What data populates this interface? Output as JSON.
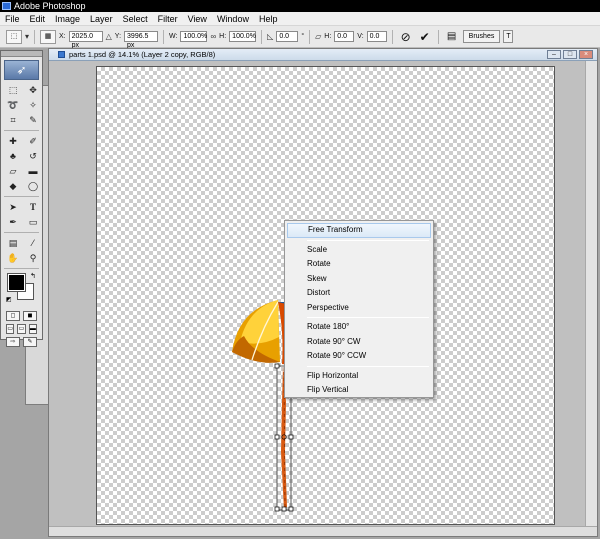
{
  "app": {
    "title": "Adobe Photoshop"
  },
  "menubar": {
    "items": [
      "File",
      "Edit",
      "Image",
      "Layer",
      "Select",
      "Filter",
      "View",
      "Window",
      "Help"
    ]
  },
  "options": {
    "x_label": "X:",
    "x_value": "2025.0 px",
    "y_label": "Y:",
    "y_value": "3996.5 px",
    "w_label": "W:",
    "w_value": "100.0%",
    "h_label": "H:",
    "h_value": "100.0%",
    "angle_value": "0.0",
    "angle_unit": "°",
    "hskew_label": "H:",
    "hskew_value": "0.0",
    "vskew_label": "V:",
    "vskew_value": "0.0",
    "brushes_tab": "Brushes",
    "next_tab": "T"
  },
  "document": {
    "title": "parts 1.psd @ 14.1% (Layer 2 copy, RGB/8)"
  },
  "context_menu": {
    "group1": [
      "Free Transform"
    ],
    "group2": [
      "Scale",
      "Rotate",
      "Skew",
      "Distort",
      "Perspective"
    ],
    "group3": [
      "Rotate 180°",
      "Rotate 90° CW",
      "Rotate 90° CCW"
    ],
    "group4": [
      "Flip Horizontal",
      "Flip Vertical"
    ]
  },
  "colors": {
    "foreground": "#000000",
    "background": "#ffffff",
    "menu_highlight": "#dbe9f7"
  }
}
